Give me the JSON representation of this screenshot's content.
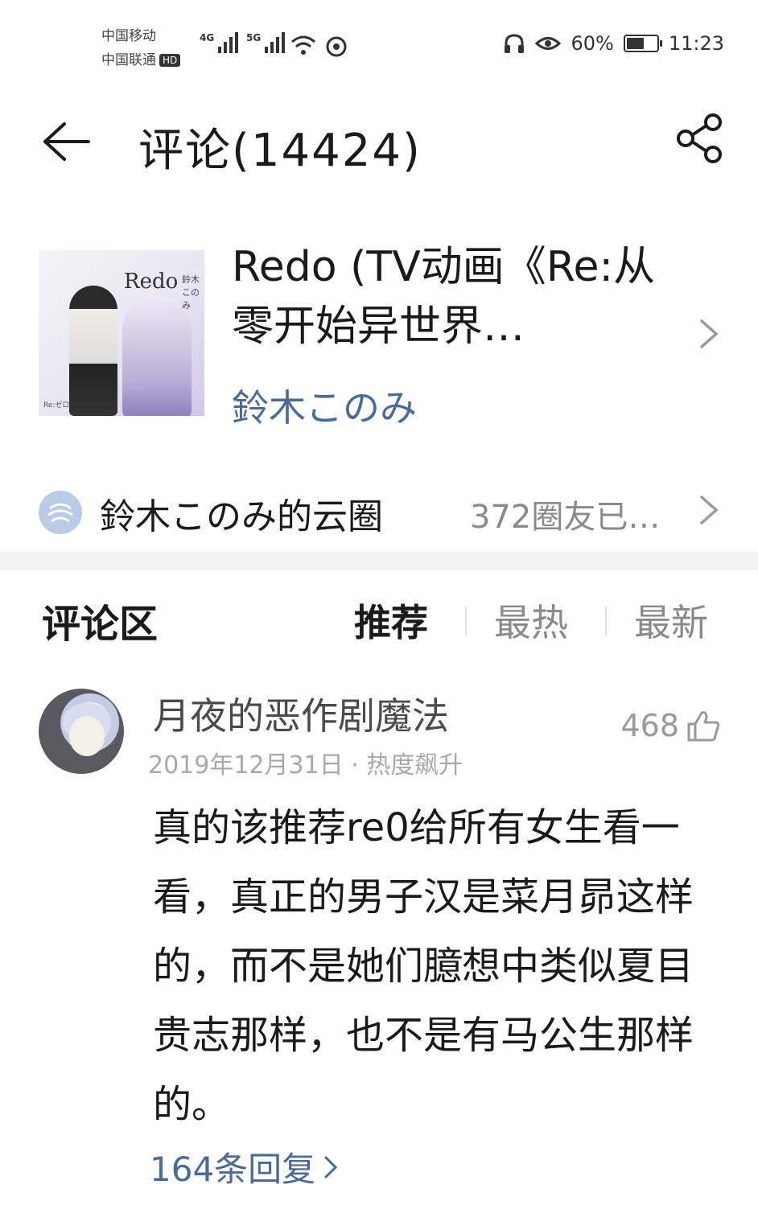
{
  "status_bar": {
    "carrier1": "中国移动",
    "carrier2": "中国联通",
    "hd_badge": "HD",
    "net1": "4G",
    "net2": "5G",
    "battery_text": "60%",
    "battery_level": 0.6,
    "time": "11:23"
  },
  "header": {
    "title": "评论(14424)"
  },
  "song": {
    "title": "Redo (TV动画《Re:从零开始异世界…",
    "artist": "鈴木このみ",
    "cover_text": "Redo",
    "cover_artist": "鈴木このみ",
    "cover_sub": "Re:ゼロ"
  },
  "circle": {
    "label": "鈴木このみ的云圈",
    "sub": "372圈友已…"
  },
  "comments_section": {
    "title": "评论区",
    "tabs": [
      "推荐",
      "最热",
      "最新"
    ],
    "active_tab": "推荐"
  },
  "comment": {
    "user": "月夜的恶作剧魔法",
    "meta": "2019年12月31日 · 热度飙升",
    "likes": "468",
    "body": "真的该推荐re0给所有女生看一看，真正的男子汉是菜月昴这样的，而不是她们臆想中类似夏目贵志那样，也不是有马公生那样的。",
    "replies": "164条回复"
  },
  "colors": {
    "link_blue": "#4a6b96",
    "muted_gray": "#8a8a8a",
    "divider": "#f2f2f2"
  }
}
